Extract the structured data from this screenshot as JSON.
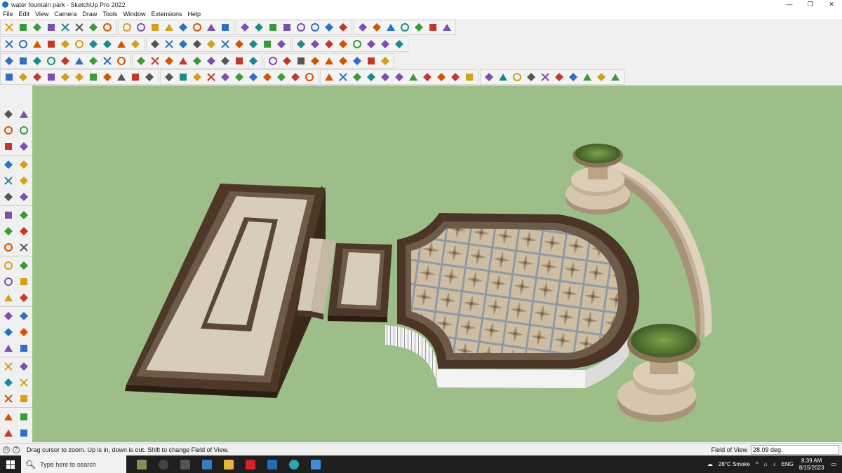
{
  "window": {
    "title": "water fountain park - SketchUp Pro 2022",
    "controls": [
      "—",
      "❐",
      "✕"
    ]
  },
  "menu": [
    "File",
    "Edit",
    "View",
    "Camera",
    "Draw",
    "Tools",
    "Window",
    "Extensions",
    "Help"
  ],
  "toolbars": {
    "row1": [
      "zoom-icon",
      "select-icon",
      "line-icon",
      "arc-icon",
      "rectangle-icon",
      "push-pull-icon",
      "follow-me-icon",
      "move-icon",
      "rotate-icon",
      "scale-icon",
      "offset-icon",
      "tape-measure-icon",
      "text-icon",
      "paint-bucket-icon",
      "orbit-icon",
      "pan-icon",
      "zoom-tool-icon",
      "zoom-extents-icon",
      "section-plane-icon",
      "layers-icon",
      "styles-icon",
      "account-icon",
      "axes-icon",
      "dimension-icon",
      "protractor-icon",
      "3d-text-icon",
      "component-icon",
      "group-icon",
      "undo-icon",
      "redo-icon",
      "model-info-icon"
    ],
    "row2": [
      "iso-view-icon",
      "top-view-icon",
      "front-view-icon",
      "right-view-icon",
      "back-view-icon",
      "left-view-icon",
      "bottom-view-icon",
      "sandbox-icon",
      "smoove-icon",
      "stamp-icon",
      "drape-icon",
      "add-detail-icon",
      "flip-edge-icon",
      "house-icon",
      "warehouse-icon",
      "extension-warehouse-icon",
      "solid-tools-icon",
      "union-icon",
      "subtract-icon",
      "trim-icon",
      "intersect-icon",
      "split-icon",
      "outer-shell-icon",
      "shape-icon",
      "eraser-icon",
      "fillet-icon",
      "chamfer-icon",
      "material-icon"
    ],
    "row3": [
      "cube-icon",
      "face-icon",
      "curve-icon",
      "bezier-icon",
      "weld-icon",
      "joint-push-pull-icon",
      "round-corner-icon",
      "extrude-icon",
      "loft-icon",
      "sweep-icon",
      "lattice-icon",
      "array-icon",
      "grid-icon",
      "roof-icon",
      "stairs-icon",
      "railing-icon",
      "column-icon",
      "beam-icon",
      "wall-icon",
      "door-icon",
      "window-icon",
      "fence-icon",
      "deck-icon",
      "patio-icon",
      "terrain-icon",
      "tree-icon",
      "plant-icon"
    ],
    "row4": [
      "edge-icon",
      "soften-icon",
      "smooth-icon",
      "hide-icon",
      "unhide-icon",
      "lock-icon",
      "unlock-icon",
      "explode-icon",
      "make-group-icon",
      "make-component-icon",
      "outliner-icon",
      "entity-info-icon",
      "scenes-icon",
      "shadows-icon",
      "fog-icon",
      "match-photo-icon",
      "soften-edges-icon",
      "instructor-icon",
      "tags-icon",
      "materials-icon",
      "components-icon",
      "styles-panel-icon",
      "layers-panel-icon",
      "solid-inspector-icon",
      "cleanup-icon",
      "profile-builder-icon",
      "fredo-tools-icon",
      "joint-icon",
      "curviloft-icon",
      "round-icon",
      "tools-on-surface-icon",
      "selection-toys-icon",
      "quad-face-icon",
      "vertex-tools-icon",
      "bezier-spline-icon",
      "extrude-by-rails-icon",
      "rotate-scale-icon",
      "lss-toolbar-icon",
      "scale-manip-icon",
      "align-icon",
      "draw-along-icon",
      "edge-tools-icon",
      "curve-shortcut-icon"
    ]
  },
  "left_tools": [
    [
      "select-arrow-icon",
      "lasso-icon"
    ],
    [
      "paint-bucket-icon",
      "eraser-icon"
    ],
    [
      "make-component-icon",
      "tag-icon"
    ],
    [
      "pencil-icon",
      "freehand-icon"
    ],
    [
      "rectangle-icon",
      "rotated-rectangle-icon"
    ],
    [
      "circle-icon",
      "polygon-icon"
    ],
    [
      "arc-icon",
      "pie-icon"
    ],
    [
      "two-point-arc-icon",
      "three-point-arc-icon"
    ],
    [
      "move-icon",
      "push-pull-icon"
    ],
    [
      "rotate-icon",
      "follow-me-icon"
    ],
    [
      "scale-icon",
      "offset-icon"
    ],
    [
      "tape-measure-icon",
      "dimension-icon"
    ],
    [
      "protractor-icon",
      "text-icon"
    ],
    [
      "axes-icon",
      "3d-text-icon"
    ],
    [
      "orbit-icon",
      "pan-icon"
    ],
    [
      "zoom-icon",
      "zoom-window-icon"
    ],
    [
      "zoom-extents-icon",
      "previous-view-icon"
    ],
    [
      "position-camera-icon",
      "look-around-icon"
    ],
    [
      "walk-icon",
      "section-plane-icon"
    ],
    [
      "sandbox-from-contours-icon",
      "sandbox-from-scratch-icon"
    ],
    [
      "smoove-icon",
      "stamp-icon"
    ]
  ],
  "status": {
    "message": "Drag cursor to zoom.  Up is in, down is out. Shift to change Field of View.",
    "vcb_label": "Field of View",
    "vcb_value": "28.09 deg."
  },
  "taskbar": {
    "search_placeholder": "Type here to search",
    "weather": "28°C  Smoke",
    "language": "ENG",
    "time": "8:39 AM",
    "date": "8/15/2023"
  },
  "colors": {
    "viewport": "#9ebe89",
    "border": "#4a3526",
    "stone": "#d8cbb8",
    "tile": "#c9b9a1"
  }
}
